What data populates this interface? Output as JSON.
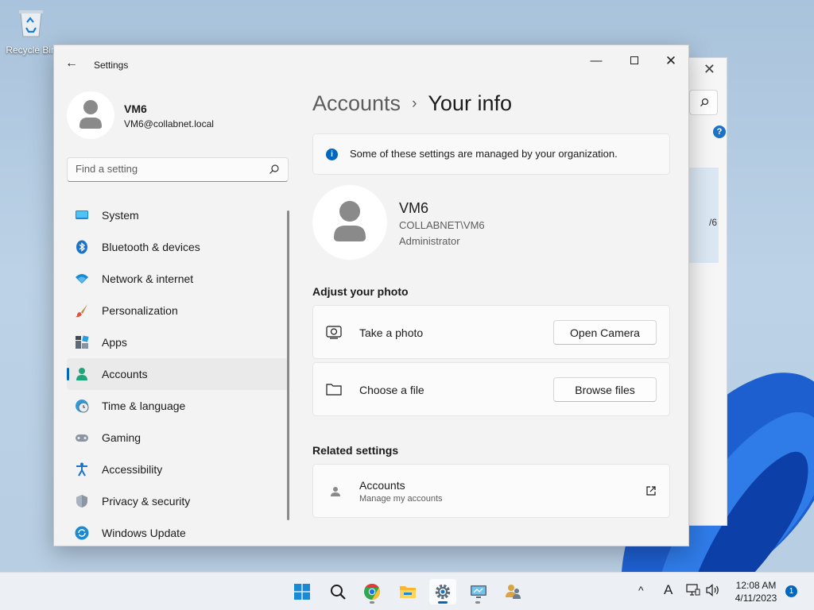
{
  "desktop": {
    "recycle_bin_label": "Recycle Bin"
  },
  "window": {
    "title": "Settings"
  },
  "user": {
    "name": "VM6",
    "email": "VM6@collabnet.local",
    "domain_account": "COLLABNET\\VM6",
    "role": "Administrator"
  },
  "search": {
    "placeholder": "Find a setting"
  },
  "nav": {
    "items": [
      {
        "label": "System",
        "icon": "system-icon"
      },
      {
        "label": "Bluetooth & devices",
        "icon": "bluetooth-icon"
      },
      {
        "label": "Network & internet",
        "icon": "wifi-icon"
      },
      {
        "label": "Personalization",
        "icon": "brush-icon"
      },
      {
        "label": "Apps",
        "icon": "apps-icon"
      },
      {
        "label": "Accounts",
        "icon": "accounts-icon",
        "active": true
      },
      {
        "label": "Time & language",
        "icon": "clock-globe-icon"
      },
      {
        "label": "Gaming",
        "icon": "gamepad-icon"
      },
      {
        "label": "Accessibility",
        "icon": "accessibility-icon"
      },
      {
        "label": "Privacy & security",
        "icon": "shield-icon"
      },
      {
        "label": "Windows Update",
        "icon": "update-icon"
      }
    ]
  },
  "breadcrumb": {
    "parent": "Accounts",
    "separator": "›",
    "current": "Your info"
  },
  "notice": {
    "text": "Some of these settings are managed by your organization."
  },
  "photo_section": {
    "heading": "Adjust your photo",
    "take_photo": {
      "label": "Take a photo",
      "button": "Open Camera"
    },
    "choose_file": {
      "label": "Choose a file",
      "button": "Browse files"
    }
  },
  "related": {
    "heading": "Related settings",
    "accounts": {
      "label": "Accounts",
      "sublabel": "Manage my accounts"
    }
  },
  "background_window": {
    "partial_text": "/6",
    "help_glyph": "?"
  },
  "taskbar": {
    "apps": [
      "start-icon",
      "search-icon",
      "chrome-icon",
      "file-explorer-icon",
      "settings-icon",
      "remote-desktop-icon",
      "users-icon"
    ],
    "tray_chevron": "^",
    "input_indicator": "A",
    "time": "12:08 AM",
    "date": "4/11/2023",
    "notification_count": "1"
  },
  "colors": {
    "accent": "#0067c0",
    "window_bg": "#f3f3f3"
  }
}
